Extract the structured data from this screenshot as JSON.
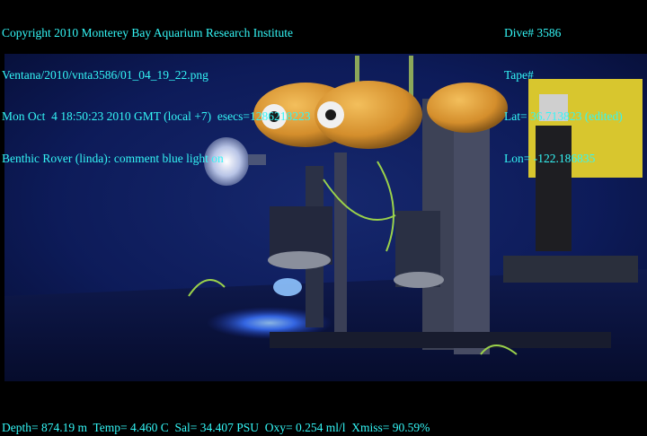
{
  "overlay": {
    "color": "#34f6f6",
    "top_left": {
      "line1": "Copyright 2010 Monterey Bay Aquarium Research Institute",
      "line2": "Ventana/2010/vnta3586/01_04_19_22.png",
      "line3": "Mon Oct  4 18:50:23 2010 GMT (local +7)  esecs=1286218223",
      "line4": "Benthic Rover (linda): comment blue light on"
    },
    "top_right": {
      "dive": "Dive# 3586",
      "tape": "Tape#",
      "lat": "Lat= 36.713823 (edited)",
      "lon": "Lon= -122.186835"
    },
    "bottom": {
      "telemetry": "Depth= 874.19 m  Temp= 4.460 C  Sal= 34.407 PSU  Oxy= 0.254 ml/l  Xmiss= 90.59%"
    }
  },
  "scene": {
    "subject": "benthic-rover-instrument-frame",
    "water_color": "#0b1a5a",
    "float_color": "#e3a23a",
    "light_color": "#2f6bff"
  }
}
